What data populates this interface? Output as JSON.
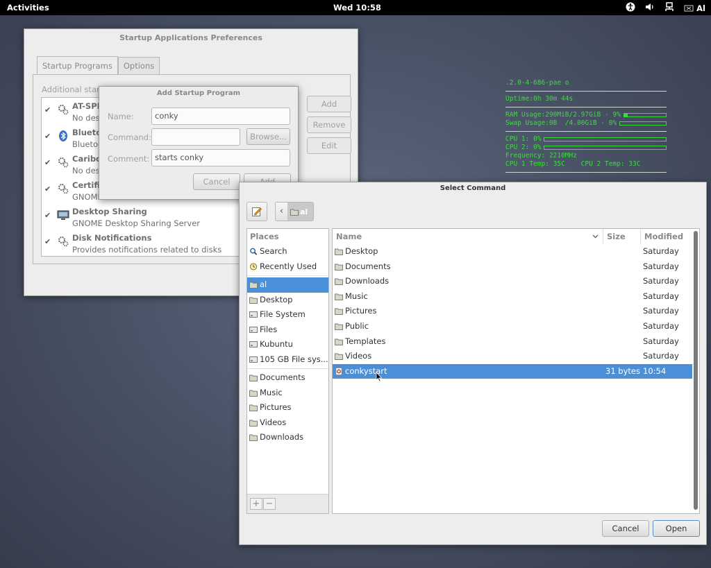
{
  "topbar": {
    "activities": "Activities",
    "clock": "Wed 10:58",
    "user": "Al",
    "icons": [
      "accessibility-icon",
      "volume-icon",
      "network-icon",
      "user-menu-icon"
    ]
  },
  "conky": {
    "kernel": ".2.0-4-686-pae o",
    "uptime": "Uptime:0h 30m 44s",
    "ram": "RAM Usage:290MiB/2.97GiB - 9%",
    "ram_percent": 9,
    "swap": "Swap Usage:0B  /4.00GiB - 0%",
    "swap_percent": 0,
    "cpu1": "CPU 1: 0%",
    "cpu1_percent": 0,
    "cpu2": "CPU 2: 0%",
    "cpu2_percent": 0,
    "frequency": "Frequency: 2210MHz",
    "temps": "CPU 1 Temp: 35C    CPU 2 Temp: 33C"
  },
  "startup": {
    "title": "Startup Applications Preferences",
    "tabs": [
      "Startup Programs",
      "Options"
    ],
    "hint": "Additional start",
    "programs": [
      {
        "name": "AT-SPI",
        "desc": "No desc"
      },
      {
        "name": "Bluetoo",
        "desc": "Bluetoo"
      },
      {
        "name": "Caribou",
        "desc": "No desc"
      },
      {
        "name": "Certific",
        "desc": "GNOME"
      },
      {
        "name": "Desktop Sharing",
        "desc": "GNOME Desktop Sharing Server"
      },
      {
        "name": "Disk Notifications",
        "desc": "Provides notifications related to disks"
      }
    ],
    "add": "Add",
    "remove": "Remove",
    "edit": "Edit"
  },
  "addprog": {
    "title": "Add Startup Program",
    "name_label": "Name:",
    "name_value": "conky",
    "command_label": "Command:",
    "command_value": "",
    "browse": "Browse...",
    "comment_label": "Comment:",
    "comment_value": "starts conky",
    "cancel": "Cancel",
    "add": "Add"
  },
  "select": {
    "title": "Select Command",
    "path_current": "al",
    "places_header": "Places",
    "places": [
      {
        "label": "Search",
        "icon": "search-icon"
      },
      {
        "label": "Recently Used",
        "icon": "clock-icon"
      }
    ],
    "devices": [
      {
        "label": "al",
        "icon": "home-folder-icon",
        "selected": true
      },
      {
        "label": "Desktop",
        "icon": "folder-icon"
      },
      {
        "label": "File System",
        "icon": "drive-icon"
      },
      {
        "label": "Files",
        "icon": "drive-icon"
      },
      {
        "label": "Kubuntu",
        "icon": "drive-icon"
      },
      {
        "label": "105 GB File sys...",
        "icon": "drive-icon"
      }
    ],
    "bookmarks": [
      {
        "label": "Documents",
        "icon": "folder-icon"
      },
      {
        "label": "Music",
        "icon": "folder-icon"
      },
      {
        "label": "Pictures",
        "icon": "folder-icon"
      },
      {
        "label": "Videos",
        "icon": "folder-icon"
      },
      {
        "label": "Downloads",
        "icon": "folder-icon"
      }
    ],
    "add_tool": "+",
    "remove_tool": "−",
    "columns": {
      "name": "Name",
      "size": "Size",
      "modified": "Modified"
    },
    "files": [
      {
        "name": "Desktop",
        "size": "",
        "modified": "Saturday",
        "icon": "folder-icon"
      },
      {
        "name": "Documents",
        "size": "",
        "modified": "Saturday",
        "icon": "folder-icon"
      },
      {
        "name": "Downloads",
        "size": "",
        "modified": "Saturday",
        "icon": "folder-icon"
      },
      {
        "name": "Music",
        "size": "",
        "modified": "Saturday",
        "icon": "folder-icon"
      },
      {
        "name": "Pictures",
        "size": "",
        "modified": "Saturday",
        "icon": "folder-icon"
      },
      {
        "name": "Public",
        "size": "",
        "modified": "Saturday",
        "icon": "folder-icon"
      },
      {
        "name": "Templates",
        "size": "",
        "modified": "Saturday",
        "icon": "folder-icon"
      },
      {
        "name": "Videos",
        "size": "",
        "modified": "Saturday",
        "icon": "folder-icon"
      },
      {
        "name": "conkystart",
        "size": "31 bytes",
        "modified": "10:54",
        "icon": "script-file-icon",
        "selected": true
      }
    ],
    "cancel": "Cancel",
    "open": "Open"
  },
  "colors": {
    "selection": "#4a90d9",
    "conky_green": "#3ddc3d"
  }
}
